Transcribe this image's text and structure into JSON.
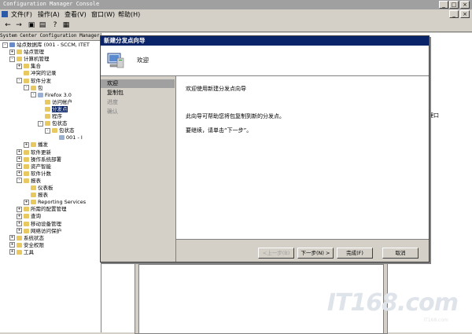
{
  "window": {
    "title": "Configuration Manager Console",
    "controls": [
      "_",
      "□",
      "×"
    ]
  },
  "menu": [
    "文件(F)",
    "操作(A)",
    "查看(V)",
    "窗口(W)",
    "帮助(H)"
  ],
  "toolbar": [
    "←",
    "→",
    "▣",
    "▤",
    "?",
    "▦"
  ],
  "tree": {
    "header": "System Center Configuration Manager",
    "nodes": [
      {
        "label": "站点数据库  (001 - SCCM, ITET",
        "indent": 0,
        "pm": "-",
        "icon": "db"
      },
      {
        "label": "站点管理",
        "indent": 1,
        "pm": "+",
        "icon": "folder"
      },
      {
        "label": "计算机管理",
        "indent": 1,
        "pm": "-",
        "icon": "folder"
      },
      {
        "label": "集合",
        "indent": 2,
        "pm": "+",
        "icon": "folder"
      },
      {
        "label": "冲突的记录",
        "indent": 2,
        "pm": "",
        "icon": "folder"
      },
      {
        "label": "软件分发",
        "indent": 2,
        "pm": "-",
        "icon": "folder"
      },
      {
        "label": "包",
        "indent": 3,
        "pm": "-",
        "icon": "folder"
      },
      {
        "label": "Firefox 3.0",
        "indent": 4,
        "pm": "-",
        "icon": "pkg"
      },
      {
        "label": "访问帐户",
        "indent": 5,
        "pm": "",
        "icon": "folder"
      },
      {
        "label": "分发点",
        "indent": 5,
        "pm": "",
        "icon": "folder",
        "selected": true
      },
      {
        "label": "程序",
        "indent": 5,
        "pm": "",
        "icon": "folder"
      },
      {
        "label": "包状态",
        "indent": 5,
        "pm": "-",
        "icon": "folder"
      },
      {
        "label": "包状态",
        "indent": 6,
        "pm": "-",
        "icon": "folder"
      },
      {
        "label": "001 - I",
        "indent": 7,
        "pm": "",
        "icon": "pkg"
      },
      {
        "label": "播发",
        "indent": 3,
        "pm": "+",
        "icon": "folder"
      },
      {
        "label": "软件更新",
        "indent": 2,
        "pm": "+",
        "icon": "folder"
      },
      {
        "label": "操作系统部署",
        "indent": 2,
        "pm": "+",
        "icon": "folder"
      },
      {
        "label": "资产智能",
        "indent": 2,
        "pm": "+",
        "icon": "folder"
      },
      {
        "label": "软件计数",
        "indent": 2,
        "pm": "+",
        "icon": "folder"
      },
      {
        "label": "报表",
        "indent": 2,
        "pm": "-",
        "icon": "folder"
      },
      {
        "label": "仪表板",
        "indent": 3,
        "pm": "",
        "icon": "folder"
      },
      {
        "label": "报表",
        "indent": 3,
        "pm": "",
        "icon": "folder"
      },
      {
        "label": "Reporting Services",
        "indent": 3,
        "pm": "+",
        "icon": "folder"
      },
      {
        "label": "所需的配置管理",
        "indent": 2,
        "pm": "+",
        "icon": "folder"
      },
      {
        "label": "查询",
        "indent": 2,
        "pm": "+",
        "icon": "folder"
      },
      {
        "label": "移动设备管理",
        "indent": 2,
        "pm": "+",
        "icon": "folder"
      },
      {
        "label": "网络访问保护",
        "indent": 2,
        "pm": "+",
        "icon": "folder"
      },
      {
        "label": "系统状态",
        "indent": 1,
        "pm": "+",
        "icon": "folder"
      },
      {
        "label": "安全权限",
        "indent": 1,
        "pm": "+",
        "icon": "folder"
      },
      {
        "label": "工具",
        "indent": 1,
        "pm": "+",
        "icon": "folder"
      }
    ]
  },
  "side_fragment": "理口",
  "watermark": {
    "logo": "IT168.com",
    "sub": "IT168.com"
  },
  "dialog": {
    "title": "新建分发点向导",
    "header": "欢迎",
    "steps": [
      {
        "label": "欢迎",
        "state": "active"
      },
      {
        "label": "复制包",
        "state": "normal"
      },
      {
        "label": "进度",
        "state": "dim"
      },
      {
        "label": "确认",
        "state": "dim"
      }
    ],
    "content": {
      "heading": "欢迎使用新建分发点向导",
      "line1": "此向导可帮助您将包复制到新的分发点。",
      "line2": "要继续，请单击“下一步”。"
    },
    "buttons": {
      "back": "<上一步(B)",
      "next": "下一步(N) >",
      "finish": "完成(F)",
      "cancel": "取消"
    }
  },
  "colors": {
    "titlebar": "#0a246a",
    "face": "#d4d0c8",
    "selection": "#0a246a"
  }
}
